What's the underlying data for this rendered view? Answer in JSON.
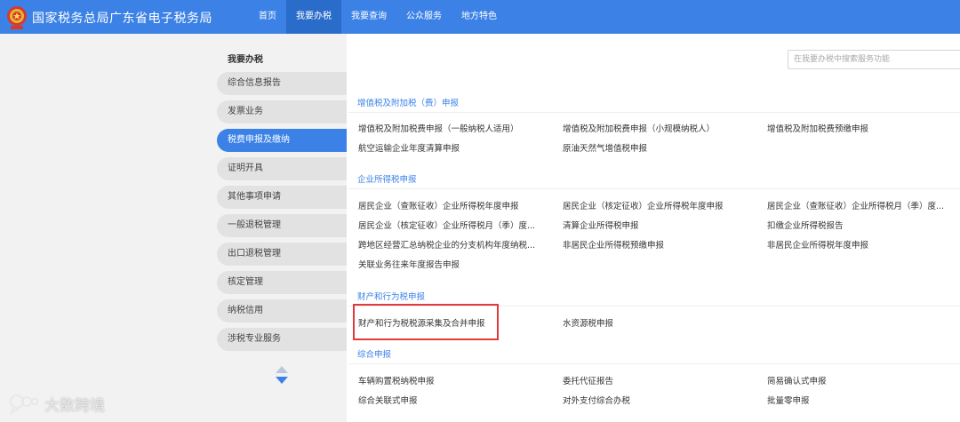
{
  "header": {
    "title": "国家税务总局广东省电子税务局",
    "nav": [
      "首页",
      "我要办税",
      "我要查询",
      "公众服务",
      "地方特色"
    ],
    "active_nav": "我要办税",
    "brand_color": "#3c82e6"
  },
  "sidebar": {
    "title": "我要办税",
    "items": [
      {
        "label": "综合信息报告"
      },
      {
        "label": "发票业务"
      },
      {
        "label": "税费申报及缴纳",
        "active": true
      },
      {
        "label": "证明开具"
      },
      {
        "label": "其他事项申请"
      },
      {
        "label": "一般退税管理"
      },
      {
        "label": "出口退税管理"
      },
      {
        "label": "核定管理"
      },
      {
        "label": "纳税信用"
      },
      {
        "label": "涉税专业服务"
      }
    ]
  },
  "search": {
    "placeholder": "在我要办税中搜索服务功能"
  },
  "sections": [
    {
      "title": "增值税及附加税（费）申报",
      "items": [
        "增值税及附加税费申报（一般纳税人适用）",
        "增值税及附加税费申报（小规模纳税人）",
        "增值税及附加税费预缴申报",
        "航空运输企业年度清算申报",
        "原油天然气增值税申报"
      ]
    },
    {
      "title": "企业所得税申报",
      "items": [
        "居民企业（查账征收）企业所得税年度申报",
        "居民企业（核定征收）企业所得税年度申报",
        "居民企业（查账征收）企业所得税月（季）度...",
        "居民企业（核定征收）企业所得税月（季）度...",
        "清算企业所得税申报",
        "扣缴企业所得税报告",
        "跨地区经营汇总纳税企业的分支机构年度纳税...",
        "非居民企业所得税预缴申报",
        "非居民企业所得税年度申报",
        "关联业务往来年度报告申报"
      ]
    },
    {
      "title": "财产和行为税申报",
      "items": [
        "财产和行为税税源采集及合并申报",
        "水资源税申报"
      ]
    },
    {
      "title": "综合申报",
      "items": [
        "车辆购置税纳税申报",
        "委托代征报告",
        "简易确认式申报",
        "综合关联式申报",
        "对外支付综合办税",
        "批量零申报"
      ]
    }
  ],
  "highlight_color": "#e23a3a",
  "watermark": {
    "text": "大数跨境"
  }
}
